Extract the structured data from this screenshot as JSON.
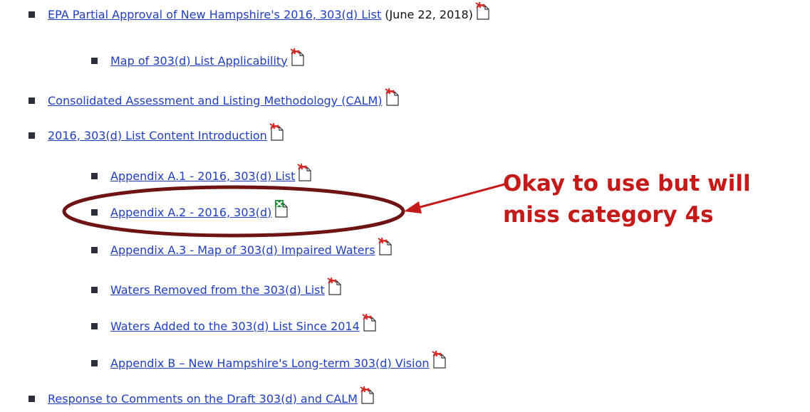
{
  "items": [
    {
      "level": 1,
      "text": "EPA Partial Approval of New Hampshire's 2016, 303(d) List",
      "suffix": "(June 22, 2018)",
      "icon": "pdf-icon"
    },
    {
      "level": 2,
      "text": "Map of 303(d) List Applicability",
      "icon": "pdf-icon"
    },
    {
      "level": 1,
      "text": "Consolidated Assessment and Listing Methodology (CALM)",
      "icon": "pdf-icon"
    },
    {
      "level": 1,
      "text": "2016, 303(d) List Content Introduction",
      "icon": "pdf-icon"
    },
    {
      "level": 2,
      "text": "Appendix A.1 - 2016, 303(d) List",
      "icon": "pdf-icon"
    },
    {
      "level": 2,
      "text": "Appendix A.2 - 2016, 303(d)",
      "icon": "excel-icon"
    },
    {
      "level": 2,
      "text": "Appendix A.3 - Map of 303(d) Impaired Waters",
      "icon": "pdf-icon"
    },
    {
      "level": 2,
      "text": "Waters Removed from the 303(d) List",
      "icon": "pdf-icon"
    },
    {
      "level": 2,
      "text": "Waters Added to the 303(d) List Since 2014",
      "icon": "pdf-icon"
    },
    {
      "level": 2,
      "text": "Appendix B – New Hampshire's Long-term 303(d) Vision",
      "icon": "pdf-icon"
    },
    {
      "level": 1,
      "text": "Response to Comments on the Draft 303(d) and CALM",
      "icon": "pdf-icon"
    }
  ],
  "annotation": {
    "line1": "Okay to use but will",
    "line2": "miss category 4s",
    "color": "#c41a1a"
  },
  "colors": {
    "link": "#1f3fbf",
    "bullet": "#2a2f3a",
    "ellipse": "#6e1414",
    "arrow": "#c41a1a"
  }
}
